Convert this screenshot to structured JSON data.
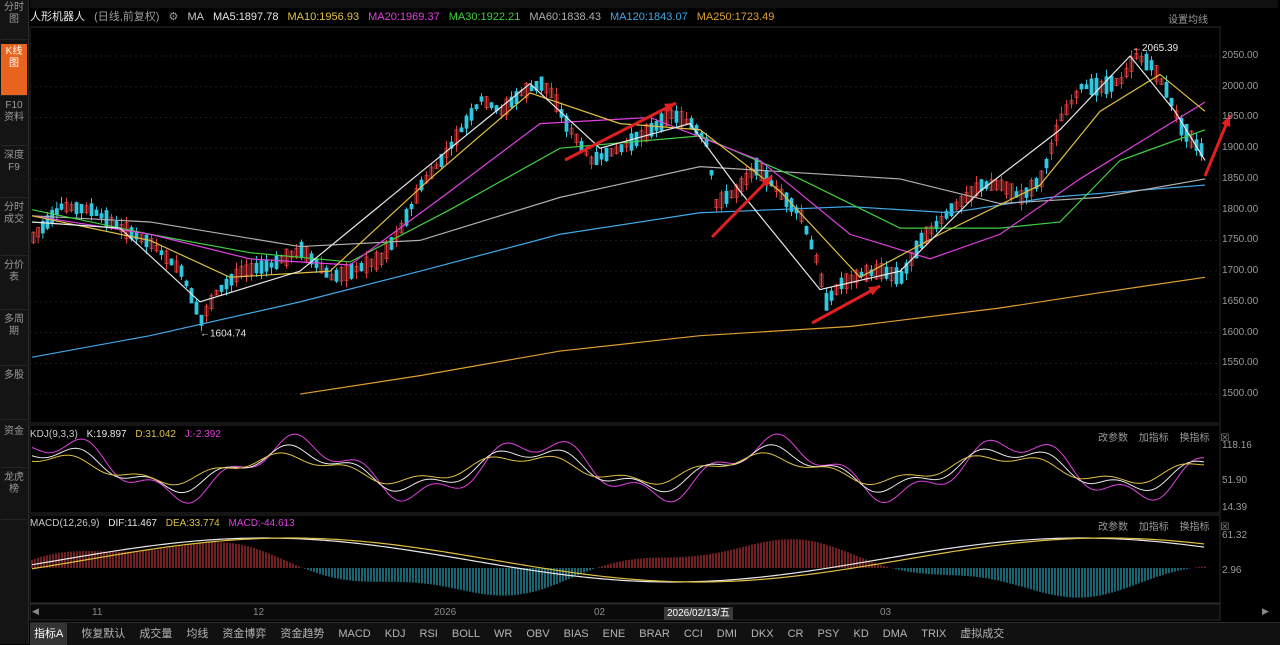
{
  "sidebar": {
    "items": [
      {
        "label": "分时图",
        "active": false
      },
      {
        "label": "K线图",
        "active": true
      },
      {
        "label": "F10资料",
        "active": false
      },
      {
        "label": "深度F9",
        "active": false
      },
      {
        "label": "分时成交",
        "active": false
      },
      {
        "label": "分价表",
        "active": false
      },
      {
        "label": "多周期",
        "active": false
      },
      {
        "label": "多股",
        "active": false
      },
      {
        "label": "资金",
        "active": false
      },
      {
        "label": "龙虎榜",
        "active": false
      }
    ]
  },
  "header": {
    "title": "人形机器人",
    "period": "(日线,前复权)",
    "ma_label": "MA",
    "ma5": "MA5:1897.78",
    "ma10": "MA10:1956.93",
    "ma20": "MA20:1969.37",
    "ma30": "MA30:1922.21",
    "ma60": "MA60:1838.43",
    "ma120": "MA120:1843.07",
    "ma250": "MA250:1723.49",
    "settings": "设置均线"
  },
  "colors": {
    "ma5": "#e8e8e8",
    "ma10": "#e0c040",
    "ma20": "#e040e0",
    "ma30": "#40d040",
    "ma60": "#b0b0b0",
    "ma120": "#40a8e8",
    "ma250": "#e0a030",
    "up": "#e04040",
    "down": "#30c8e0"
  },
  "main_chart": {
    "y_ticks": [
      "2050.00",
      "2000.00",
      "1950.00",
      "1900.00",
      "1850.00",
      "1800.00",
      "1750.00",
      "1700.00",
      "1650.00",
      "1600.00",
      "1550.00",
      "1500.00"
    ],
    "high_label": "2065.39",
    "low_label": "1604.74"
  },
  "kdj": {
    "label": "KDJ(9,3,3)",
    "k": "K:19.897",
    "d": "D:31.042",
    "j": "J:-2.392",
    "y_ticks": [
      "118.16",
      "51.90",
      "14.39"
    ],
    "buttons": [
      "改参数",
      "加指标",
      "换指标"
    ]
  },
  "macd": {
    "label": "MACD(12,26,9)",
    "dif": "DIF:11.467",
    "dea": "DEA:33.774",
    "macd": "MACD:-44.613",
    "y_ticks": [
      "61.32",
      "2.96"
    ],
    "buttons": [
      "改参数",
      "加指标",
      "换指标"
    ]
  },
  "x_axis": {
    "labels": [
      "11",
      "12",
      "2026",
      "02",
      "03"
    ],
    "highlight": "2026/02/13/五"
  },
  "bottom_tabs": [
    "指标A",
    "恢复默认",
    "成交量",
    "均线",
    "资金博弈",
    "资金趋势",
    "MACD",
    "KDJ",
    "RSI",
    "BOLL",
    "WR",
    "OBV",
    "BIAS",
    "ENE",
    "BRAR",
    "CCI",
    "DMI",
    "DKX",
    "CR",
    "PSY",
    "KD",
    "DMA",
    "TRIX",
    "虚拟成交"
  ]
}
